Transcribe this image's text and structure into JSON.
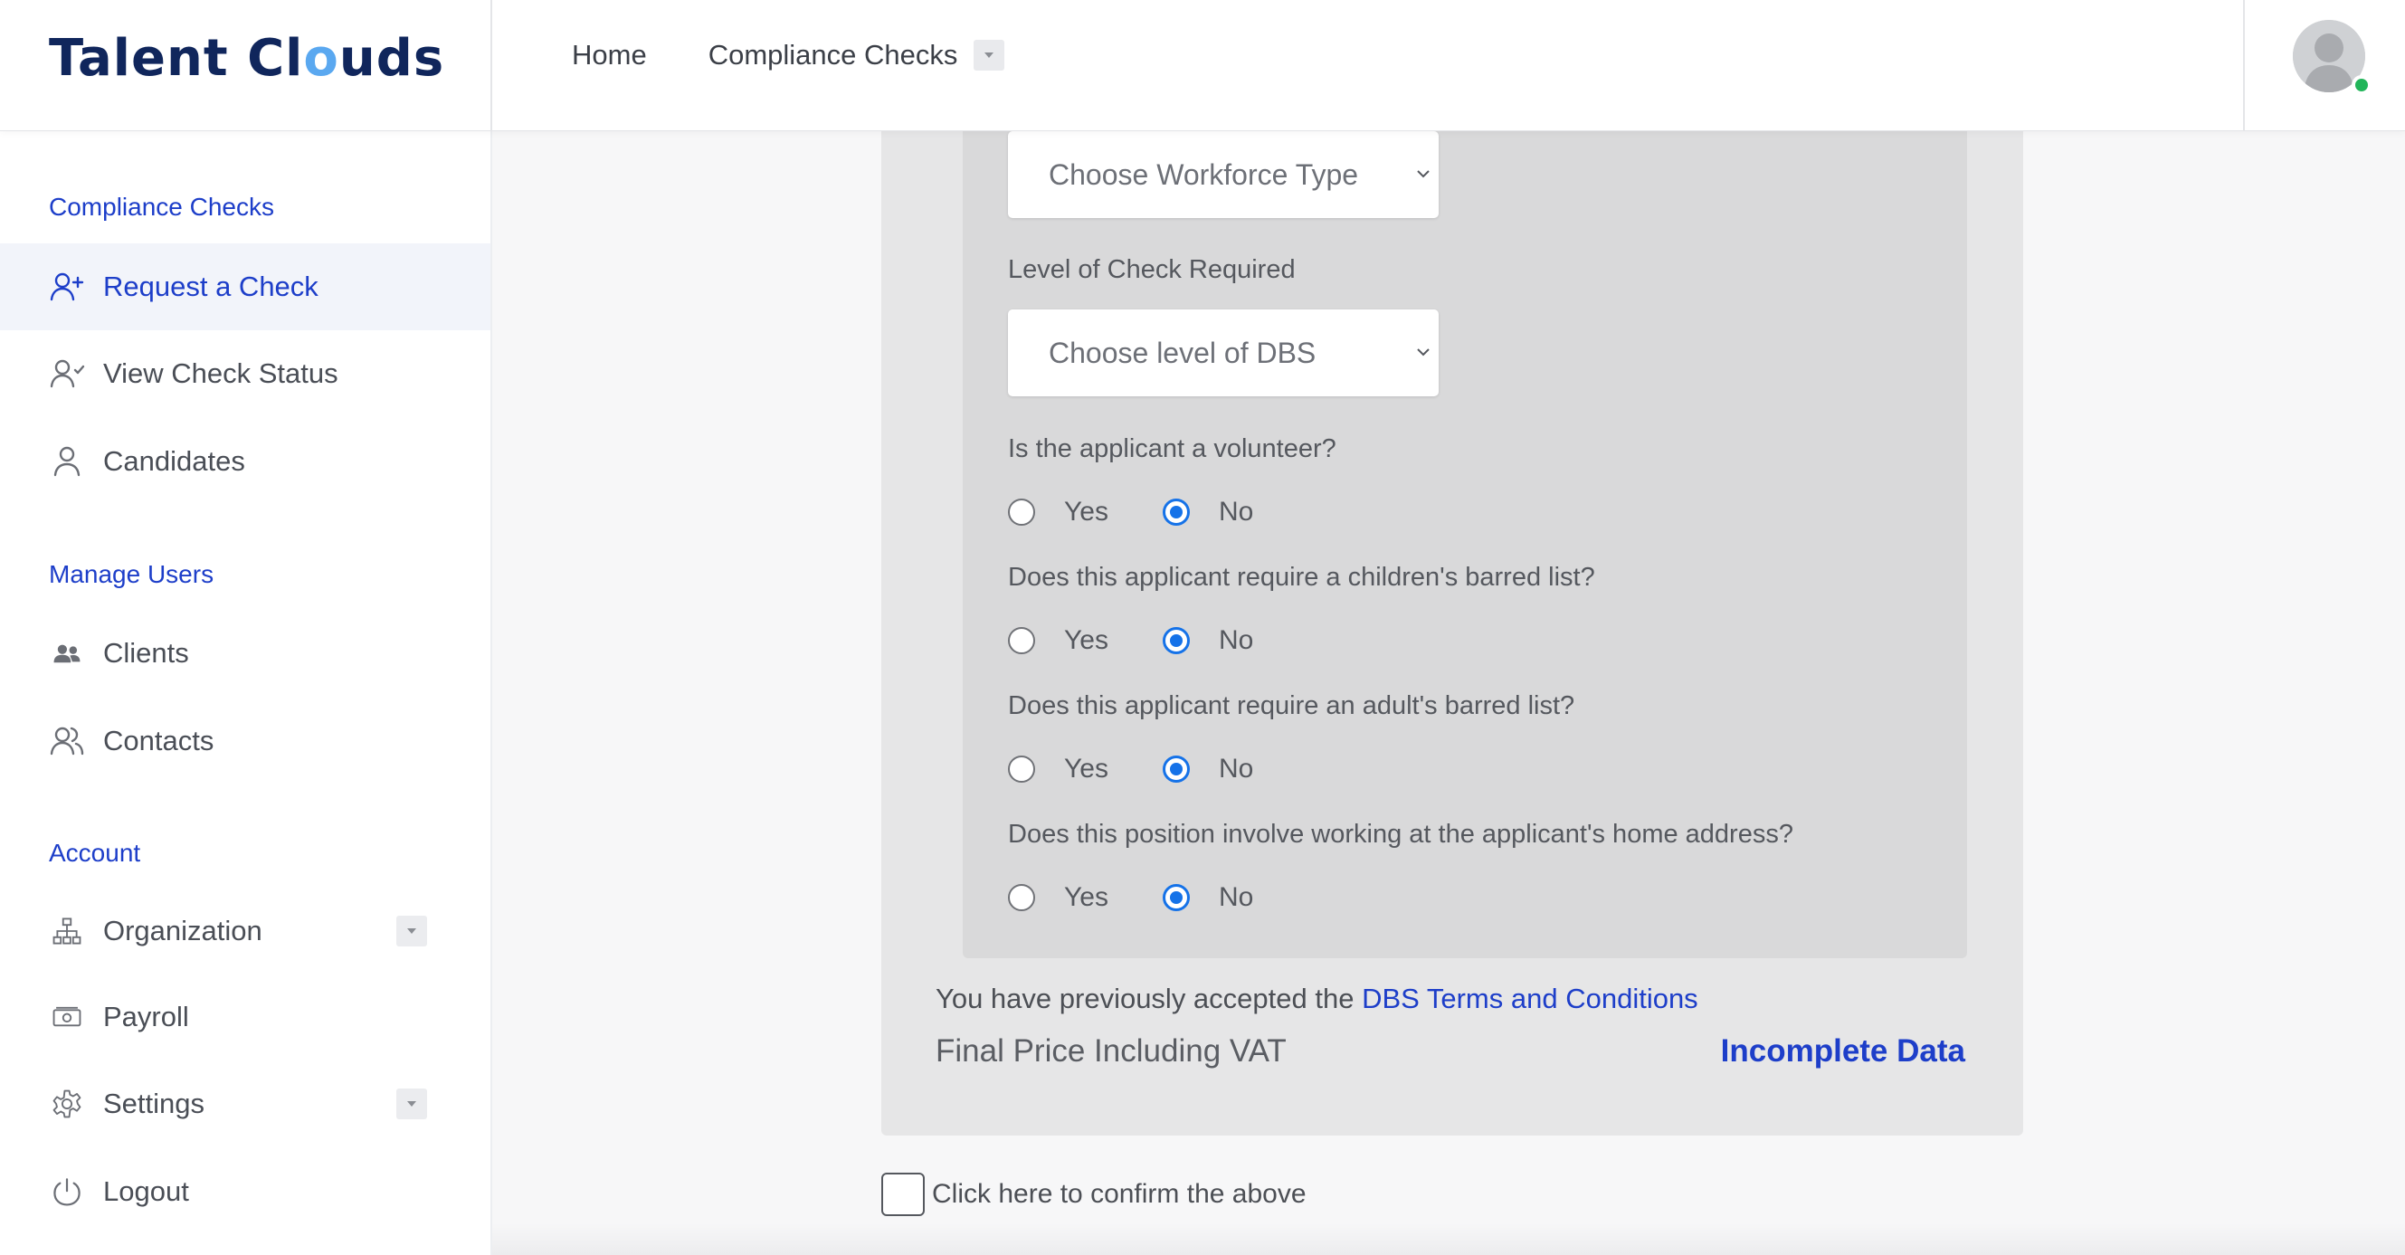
{
  "brand": {
    "logo_pre": "Talent Cl",
    "logo_o": "o",
    "logo_post": "uds"
  },
  "topnav": {
    "home": "Home",
    "compliance_checks": "Compliance Checks",
    "compliance_icon": "chevron-down-icon"
  },
  "user": {
    "avatar_icon": "user-avatar-icon",
    "status": "online",
    "status_color": "#22b55a"
  },
  "sidebar": {
    "sections": {
      "compliance": "Compliance Checks",
      "manage_users": "Manage Users",
      "account": "Account"
    },
    "items": {
      "request": {
        "label": "Request a Check",
        "icon": "user-plus-icon",
        "active": true
      },
      "view_status": {
        "label": "View Check Status",
        "icon": "user-check-icon"
      },
      "candidates": {
        "label": "Candidates",
        "icon": "user-icon"
      },
      "clients": {
        "label": "Clients",
        "icon": "users-icon"
      },
      "contacts": {
        "label": "Contacts",
        "icon": "contacts-icon"
      },
      "organization": {
        "label": "Organization",
        "icon": "org-chart-icon",
        "expandable": true
      },
      "payroll": {
        "label": "Payroll",
        "icon": "money-icon"
      },
      "settings": {
        "label": "Settings",
        "icon": "gear-icon",
        "expandable": true
      },
      "logout": {
        "label": "Logout",
        "icon": "power-icon"
      }
    }
  },
  "form": {
    "workforce_select": {
      "placeholder": "Choose Workforce Type"
    },
    "level_label": "Level of Check Required",
    "level_select": {
      "placeholder": "Choose level of DBS"
    },
    "questions": [
      {
        "text": "Is the applicant a volunteer?",
        "yes": "Yes",
        "no": "No",
        "selected": "No"
      },
      {
        "text": "Does this applicant require a children's barred list?",
        "yes": "Yes",
        "no": "No",
        "selected": "No"
      },
      {
        "text": "Does this applicant require an adult's barred list?",
        "yes": "Yes",
        "no": "No",
        "selected": "No"
      },
      {
        "text": "Does this position involve working at the applicant's home address?",
        "yes": "Yes",
        "no": "No",
        "selected": "No"
      }
    ],
    "terms_prefix": "You have previously accepted the ",
    "terms_link": "DBS Terms and Conditions",
    "price_label": "Final Price Including VAT",
    "price_value": "Incomplete Data",
    "confirm_label": "Click here to confirm the above",
    "confirm_checked": false
  },
  "colors": {
    "accent": "#1d3ec9",
    "brand_dark": "#10265c",
    "radio_selected": "#1572e8"
  }
}
